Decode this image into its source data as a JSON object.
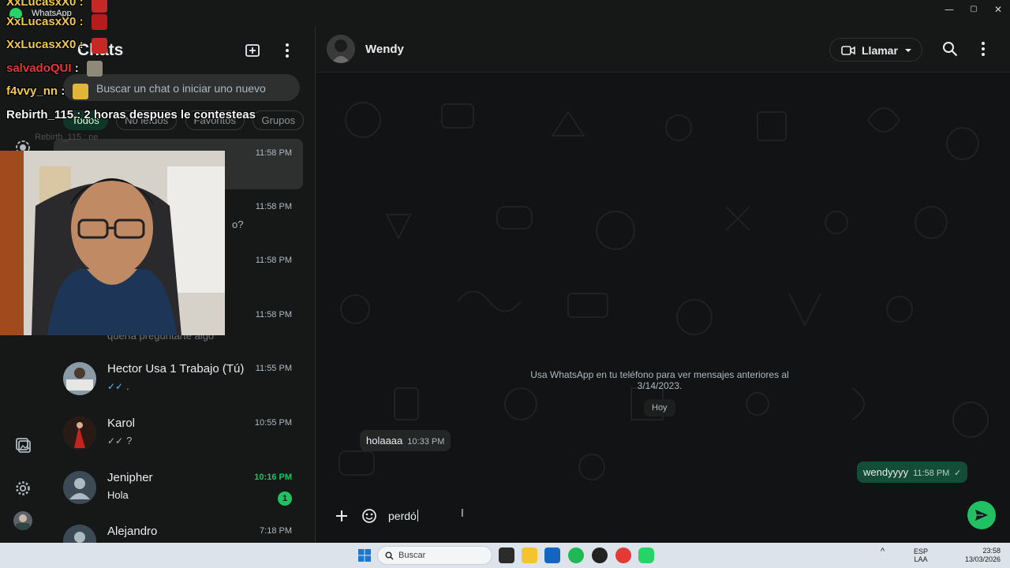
{
  "window": {
    "app_title": "WhatsApp",
    "controls": [
      "—",
      "▢",
      "✕"
    ]
  },
  "sidebar": {
    "title": "Chats",
    "search_placeholder": "Buscar un chat o iniciar uno nuevo",
    "filters": [
      "Todos",
      "No leídos",
      "Favoritos",
      "Grupos"
    ],
    "chats": [
      {
        "name": "",
        "preview": "",
        "time": "11:58 PM",
        "selected": true
      },
      {
        "name": "",
        "preview": "o?",
        "time": "11:58 PM"
      },
      {
        "name": "",
        "preview": "",
        "time": "11:58 PM"
      },
      {
        "name": "",
        "preview": "quería preguntarte algo",
        "time": "11:58 PM"
      },
      {
        "name": "Hector Usa 1 Trabajo (Tú)",
        "preview": ".",
        "ticks": "✓✓",
        "time": "11:55 PM"
      },
      {
        "name": "Karol",
        "preview": "?",
        "ticks": "✓✓",
        "time": "10:55 PM"
      },
      {
        "name": "Jenipher",
        "preview": "Hola",
        "time": "10:16 PM",
        "unread": "1"
      },
      {
        "name": "Alejandro",
        "preview": "",
        "time": "7:18 PM"
      }
    ]
  },
  "conversation": {
    "contact_name": "Wendy",
    "call_label": "Llamar",
    "system_note": "Usa WhatsApp en tu teléfono para ver mensajes anteriores al 3/14/2023.",
    "day_label": "Hoy",
    "messages": [
      {
        "direction": "in",
        "text": "holaaaa",
        "time": "10:33 PM"
      },
      {
        "direction": "out",
        "text": "wendyyyy",
        "time": "11:58 PM",
        "status": "✓"
      }
    ],
    "composer_text": "perdó"
  },
  "stream_overlay": {
    "lines": [
      {
        "user": "XxLucasxX0",
        "text": ":",
        "color": "#f2c94c"
      },
      {
        "user": "XxLucasxX0",
        "text": ":",
        "color": "#f2c94c"
      },
      {
        "user": "XxLucasxX0",
        "text": ":",
        "color": "#f2c94c"
      },
      {
        "user": "salvadoQUI",
        "text": ":",
        "color": "#e53935"
      },
      {
        "user": "f4vvy_nn",
        "text": ":",
        "color": "#f2c94c"
      },
      {
        "user": "Rebirth_115",
        "text": ": 2 horas despues le contesteas",
        "color": "#f5f5f5"
      }
    ],
    "ghost_line": "Rebirth_115 : ne"
  },
  "taskbar": {
    "search_label": "Buscar",
    "lang_top": "ESP",
    "lang_bottom": "LAA",
    "time": "23:58",
    "date": "13/03/2026"
  },
  "colors": {
    "accent_green": "#21c063",
    "outgoing_bubble": "#144d37",
    "incoming_bubble": "#242626",
    "read_ticks": "#53bdeb"
  }
}
